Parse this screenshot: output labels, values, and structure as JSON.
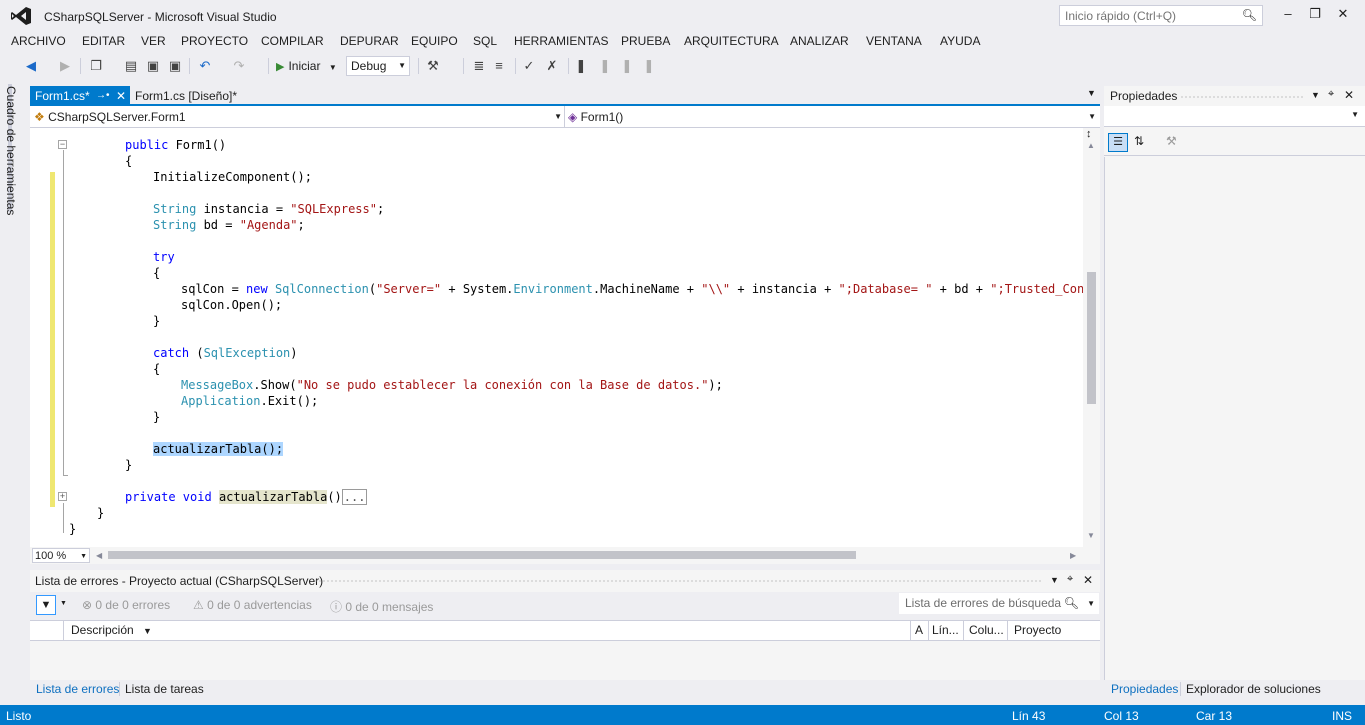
{
  "window": {
    "title": "CSharpSQLServer - Microsoft Visual Studio",
    "quick_launch_placeholder": "Inicio rápido (Ctrl+Q)"
  },
  "menu": [
    "ARCHIVO",
    "EDITAR",
    "VER",
    "PROYECTO",
    "COMPILAR",
    "DEPURAR",
    "EQUIPO",
    "SQL",
    "HERRAMIENTAS",
    "PRUEBA",
    "ARQUITECTURA",
    "ANALIZAR",
    "VENTANA",
    "AYUDA"
  ],
  "toolbar": {
    "start_label": "Iniciar",
    "config": "Debug"
  },
  "toolbox": {
    "label": "Cuadro de herramientas"
  },
  "tabs": [
    {
      "label": "Form1.cs*",
      "active": true
    },
    {
      "label": "Form1.cs [Diseño]*",
      "active": false
    }
  ],
  "navbar": {
    "class_scope": "CSharpSQLServer.Form1",
    "member_scope": "Form1()"
  },
  "code": {
    "l1_kw": "public",
    "l1_rest": " Form1()",
    "l2": "{",
    "l3": "InitializeComponent();",
    "l4_type": "String",
    "l4_mid": " instancia = ",
    "l4_str": "\"SQLExpress\"",
    "l4_end": ";",
    "l5_type": "String",
    "l5_mid": " bd = ",
    "l5_str": "\"Agenda\"",
    "l5_end": ";",
    "l6_kw": "try",
    "l7": "{",
    "l8_a": "sqlCon = ",
    "l8_kw": "new",
    "l8_type": " SqlConnection",
    "l8_b": "(",
    "l8_str1": "\"Server=\"",
    "l8_c": " + System.",
    "l8_type2": "Environment",
    "l8_d": ".MachineName + ",
    "l8_str2": "\"\\\\\"",
    "l8_e": " + instancia + ",
    "l8_str3": "\";Database= \"",
    "l8_f": " + bd + ",
    "l8_str4": "\";Trusted_Connect",
    "l9": "sqlCon.Open();",
    "l10": "}",
    "l11_kw": "catch",
    "l11_a": " (",
    "l11_type": "SqlException",
    "l11_b": ")",
    "l12": "{",
    "l13_type": "MessageBox",
    "l13_a": ".Show(",
    "l13_str": "\"No se pudo establecer la conexión con la Base de datos.\"",
    "l13_b": ");",
    "l14_type": "Application",
    "l14_a": ".Exit();",
    "l15": "}",
    "l16": "actualizarTabla();",
    "l17": "}",
    "l18_kw1": "private",
    "l18_kw2": " void",
    "l18_sp": " ",
    "l18_name": "actualizarTabla",
    "l18_paren": "()",
    "l18_collapsed": "...",
    "l19": "}",
    "l20": "}"
  },
  "zoom": "100 %",
  "properties": {
    "title": "Propiedades"
  },
  "errors": {
    "title": "Lista de errores - Proyecto actual (CSharpSQLServer)",
    "filter_errors": "0 de 0 errores",
    "filter_warnings": "0 de 0 advertencias",
    "filter_messages": "0 de 0 mensajes",
    "search_placeholder": "Lista de errores de búsqueda",
    "columns": [
      "Descripción",
      "A",
      "Lín...",
      "Colu...",
      "Proyecto"
    ]
  },
  "bottom_tabs": {
    "left": [
      "Lista de errores",
      "Lista de tareas"
    ],
    "right": [
      "Propiedades",
      "Explorador de soluciones"
    ]
  },
  "status": {
    "state": "Listo",
    "line": "Lín 43",
    "col": "Col 13",
    "char": "Car 13",
    "mode": "INS"
  },
  "colors": {
    "accent": "#007ACC",
    "keyword": "#0000FF",
    "type": "#2B91AF",
    "string": "#A31515"
  }
}
